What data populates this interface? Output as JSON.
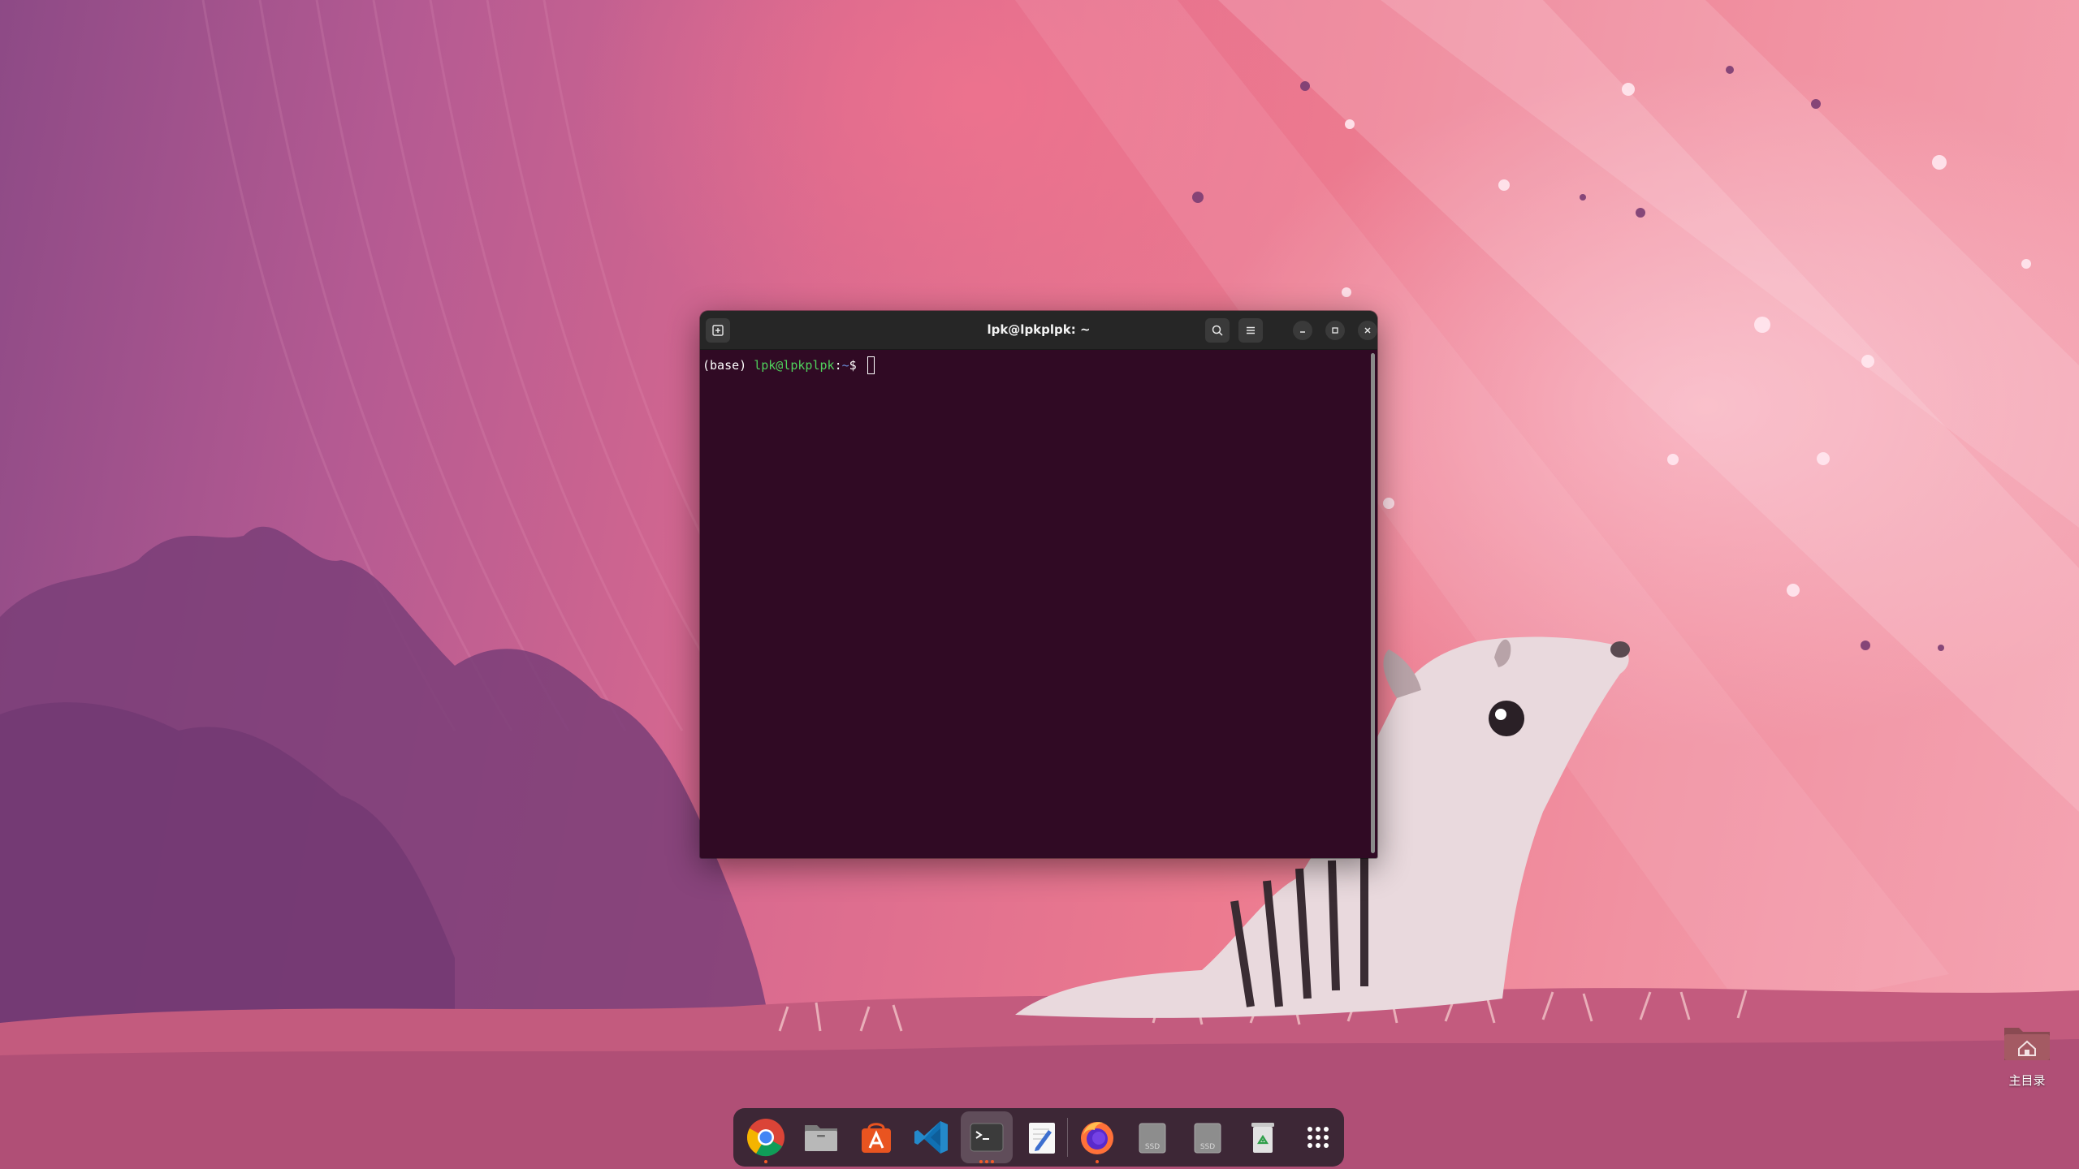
{
  "terminal": {
    "title": "lpk@lpkplpk: ~",
    "prompt": {
      "env": "(base) ",
      "user_host": "lpk@lpkplpk",
      "sep": ":",
      "path": "~",
      "dollar": "$ "
    },
    "buttons": [
      "new-tab",
      "search",
      "menu",
      "minimize",
      "maximize",
      "close"
    ]
  },
  "dock": {
    "items": [
      {
        "name": "chrome",
        "icon": "chrome-icon",
        "running": true
      },
      {
        "name": "files",
        "icon": "folder-icon",
        "running": false
      },
      {
        "name": "app-center",
        "icon": "app-store-icon",
        "running": false
      },
      {
        "name": "vscode",
        "icon": "vscode-icon",
        "running": false
      },
      {
        "name": "terminal",
        "icon": "terminal-icon",
        "running": true,
        "active": true
      },
      {
        "name": "text-editor",
        "icon": "text-editor-icon",
        "running": false
      },
      {
        "name": "firefox",
        "icon": "firefox-icon",
        "running": true
      },
      {
        "name": "ssd-drive-1",
        "icon": "drive-icon",
        "label": "SSD"
      },
      {
        "name": "ssd-drive-2",
        "icon": "drive-icon",
        "label": "SSD"
      },
      {
        "name": "trash",
        "icon": "trash-icon"
      },
      {
        "name": "show-apps",
        "icon": "app-grid-icon"
      }
    ],
    "ssd1_label": "SSD",
    "ssd2_label": "SSD"
  },
  "desktop": {
    "home_folder_label": "主目录"
  },
  "colors": {
    "terminal_bg": "#300a24",
    "prompt_user": "#4fd25c",
    "prompt_path": "#6a8edb",
    "running_dot": "#f05a2a"
  }
}
